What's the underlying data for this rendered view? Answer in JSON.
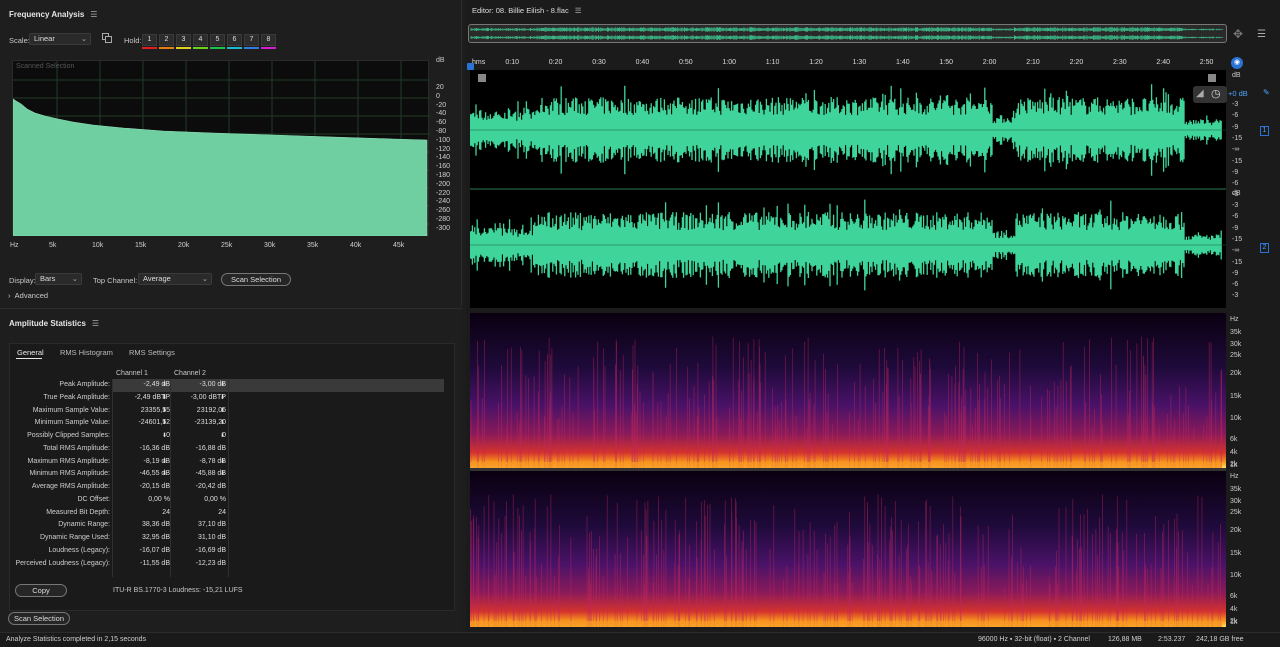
{
  "freq_panel": {
    "title": "Frequency Analysis",
    "scale_label": "Scale:",
    "scale_value": "Linear",
    "hold_label": "Hold:",
    "hold_buttons": [
      "1",
      "2",
      "3",
      "4",
      "5",
      "6",
      "7",
      "8"
    ],
    "hold_colors": [
      "#e01f1f",
      "#e87d12",
      "#e0d21a",
      "#6ecf1d",
      "#1cc34a",
      "#1ab9cf",
      "#2f7de0",
      "#d420c9"
    ],
    "graph_overlay": "Scanned Selection",
    "db_unit": "dB",
    "db_ticks": [
      "20",
      "0",
      "-20",
      "-40",
      "-60",
      "-80",
      "-100",
      "-120",
      "-140",
      "-160",
      "-180",
      "-200",
      "-220",
      "-240",
      "-260",
      "-280",
      "-300"
    ],
    "hz_ticks": [
      "Hz",
      "5k",
      "10k",
      "15k",
      "20k",
      "25k",
      "30k",
      "35k",
      "40k",
      "45k"
    ],
    "display_label": "Display:",
    "display_value": "Bars",
    "top_channel_label": "Top Channel:",
    "top_channel_value": "Average",
    "scan_selection": "Scan Selection",
    "advanced": "Advanced",
    "spectrum_color": "#6fcfa0"
  },
  "amp_panel": {
    "title": "Amplitude Statistics",
    "tabs": [
      "General",
      "RMS Histogram",
      "RMS Settings"
    ],
    "col_headers": [
      "Channel 1",
      "Channel 2"
    ],
    "rows": [
      {
        "label": "Peak Amplitude:",
        "c1": "-2,49 dB",
        "c2": "-3,00 dB",
        "pin": true
      },
      {
        "label": "True Peak Amplitude:",
        "c1": "-2,49 dBTP",
        "c2": "-3,00 dBTP",
        "pin": true
      },
      {
        "label": "Maximum Sample Value:",
        "c1": "23355,55",
        "c2": "23192,05",
        "pin": true
      },
      {
        "label": "Minimum Sample Value:",
        "c1": "-24601,52",
        "c2": "-23139,20",
        "pin": true
      },
      {
        "label": "Possibly Clipped Samples:",
        "c1": "0",
        "c2": "0",
        "pin": true
      },
      {
        "label": "Total RMS Amplitude:",
        "c1": "-16,36 dB",
        "c2": "-16,88 dB",
        "pin": false
      },
      {
        "label": "Maximum RMS Amplitude:",
        "c1": "-8,19 dB",
        "c2": "-8,78 dB",
        "pin": true
      },
      {
        "label": "Minimum RMS Amplitude:",
        "c1": "-46,55 dB",
        "c2": "-45,88 dB",
        "pin": true
      },
      {
        "label": "Average RMS Amplitude:",
        "c1": "-20,15 dB",
        "c2": "-20,42 dB",
        "pin": false
      },
      {
        "label": "DC Offset:",
        "c1": "0,00 %",
        "c2": "0,00 %",
        "pin": false
      },
      {
        "label": "Measured Bit Depth:",
        "c1": "24",
        "c2": "24",
        "pin": false
      },
      {
        "label": "Dynamic Range:",
        "c1": "38,36 dB",
        "c2": "37,10 dB",
        "pin": false
      },
      {
        "label": "Dynamic Range Used:",
        "c1": "32,95 dB",
        "c2": "31,10 dB",
        "pin": false
      },
      {
        "label": "Loudness (Legacy):",
        "c1": "-16,07 dB",
        "c2": "-16,69 dB",
        "pin": false
      },
      {
        "label": "Perceived Loudness (Legacy):",
        "c1": "-11,55 dB",
        "c2": "-12,23 dB",
        "pin": false
      }
    ],
    "copy": "Copy",
    "lufs": "ITU-R BS.1770-3 Loudness: -15,21 LUFS",
    "scan_selection": "Scan Selection"
  },
  "editor": {
    "title": "Editor: 08. Billie Eilish - 8.flac",
    "time_labels": [
      "hms",
      "0:10",
      "0:20",
      "0:30",
      "0:40",
      "0:50",
      "1:00",
      "1:10",
      "1:20",
      "1:30",
      "1:40",
      "1:50",
      "2:00",
      "2:10",
      "2:20",
      "2:30",
      "2:40",
      "2:50"
    ],
    "volume": "+0 dB",
    "db_unit": "dB",
    "ch1_db": [
      "-3",
      "-6",
      "-9",
      "-15",
      "-∞",
      "-15",
      "-9",
      "-6",
      "-3"
    ],
    "ch2_db": [
      "-3",
      "-6",
      "-9",
      "-15",
      "-∞",
      "-15",
      "-9",
      "-6",
      "-3"
    ],
    "ch1_badge": "1",
    "ch2_badge": "2",
    "hz_unit": "Hz",
    "spec1_hz": [
      "35k",
      "30k",
      "25k",
      "20k",
      "15k",
      "10k",
      "6k",
      "4k",
      "2k",
      "1k"
    ],
    "spec2_hz": [
      "35k",
      "30k",
      "25k",
      "20k",
      "15k",
      "10k",
      "6k",
      "4k",
      "2k",
      "1k"
    ],
    "wave_color": "#3fd59a"
  },
  "status": {
    "left": "Analyze Statistics completed in 2,15 seconds",
    "format": "96000 Hz ▪ 32-bit (float) ▪ 2 Channel",
    "size": "126,88 MB",
    "duration": "2:53.237",
    "free": "242,18 GB free"
  }
}
